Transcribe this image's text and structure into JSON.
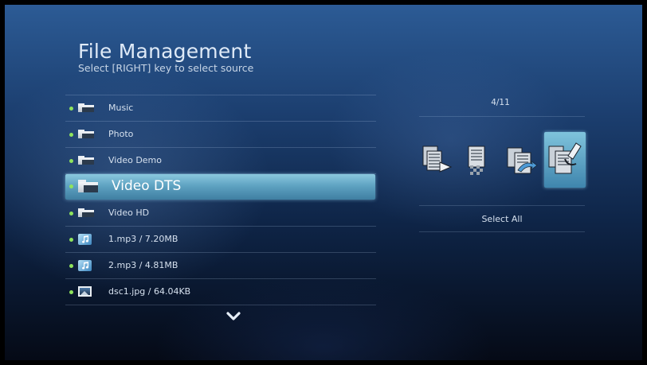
{
  "header": {
    "title": "File Management",
    "subtitle": "Select [RIGHT] key to select source"
  },
  "file_list": {
    "items": [
      {
        "label": "Music",
        "icon": "folder-icon"
      },
      {
        "label": "Photo",
        "icon": "folder-icon"
      },
      {
        "label": "Video Demo",
        "icon": "folder-icon"
      },
      {
        "label": "Video DTS",
        "icon": "folder-icon",
        "selected": true
      },
      {
        "label": "Video HD",
        "icon": "folder-icon"
      },
      {
        "label": "1.mp3 / 7.20MB",
        "icon": "music-file-icon"
      },
      {
        "label": "2.mp3 / 4.81MB",
        "icon": "music-file-icon"
      },
      {
        "label": "dsc1.jpg / 64.04KB",
        "icon": "photo-file-icon"
      }
    ],
    "more_icon": "chevron-down-icon"
  },
  "actions": {
    "counter": "4/11",
    "buttons": [
      {
        "name": "copy-icon"
      },
      {
        "name": "delete-icon"
      },
      {
        "name": "move-icon"
      },
      {
        "name": "select-all-icon",
        "selected": true
      }
    ],
    "selected_label": "Select All"
  },
  "colors": {
    "highlight": "#5fa3c2",
    "bullet": "#8fe35c",
    "background_top": "#2c5b95",
    "background_bottom": "#050a16"
  }
}
